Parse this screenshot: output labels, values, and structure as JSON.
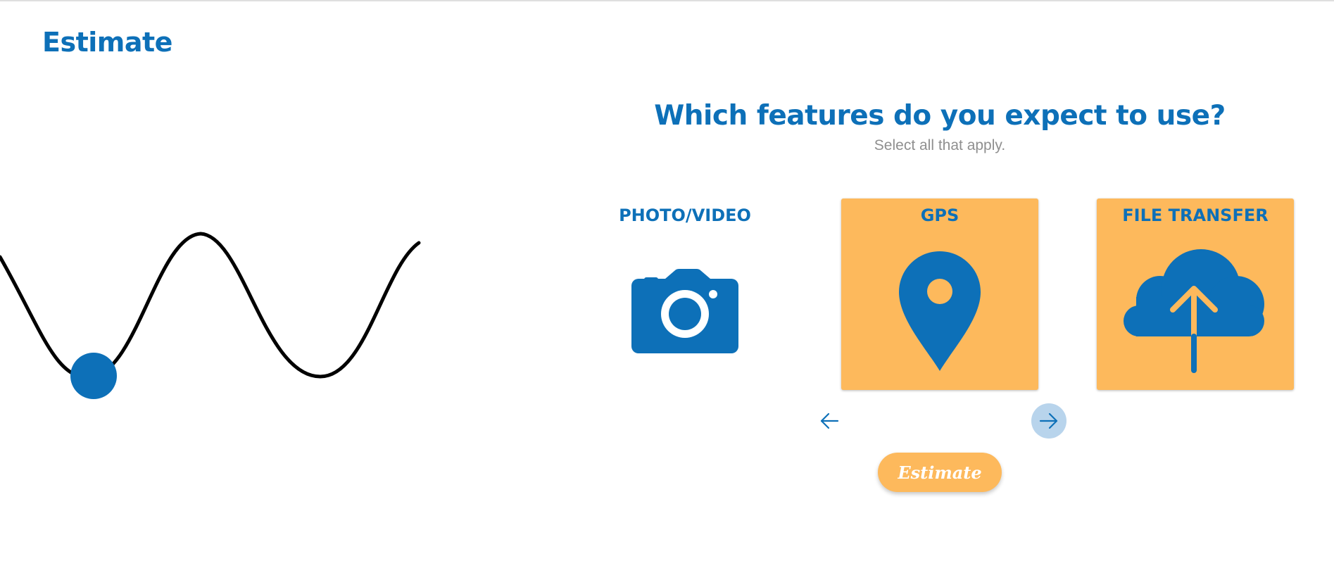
{
  "page": {
    "title": "Estimate"
  },
  "question": {
    "heading": "Which features do you expect to use?",
    "subtitle": "Select all that apply."
  },
  "features": [
    {
      "label": "PHOTO/VIDEO",
      "icon": "camera-icon",
      "selected": false
    },
    {
      "label": "GPS",
      "icon": "map-pin-icon",
      "selected": true
    },
    {
      "label": "FILE TRANSFER",
      "icon": "cloud-upload-icon",
      "selected": true
    }
  ],
  "navigation": {
    "prev_icon": "arrow-left-icon",
    "next_icon": "arrow-right-icon"
  },
  "actions": {
    "estimate_label": "Estimate"
  },
  "colors": {
    "primary": "#0d70b8",
    "accent": "#fdb95c",
    "muted_text": "#8f8f8f",
    "next_button_bg": "#b8d4ec"
  },
  "decoration": {
    "wave_icon": "sine-wave-loader-icon"
  }
}
